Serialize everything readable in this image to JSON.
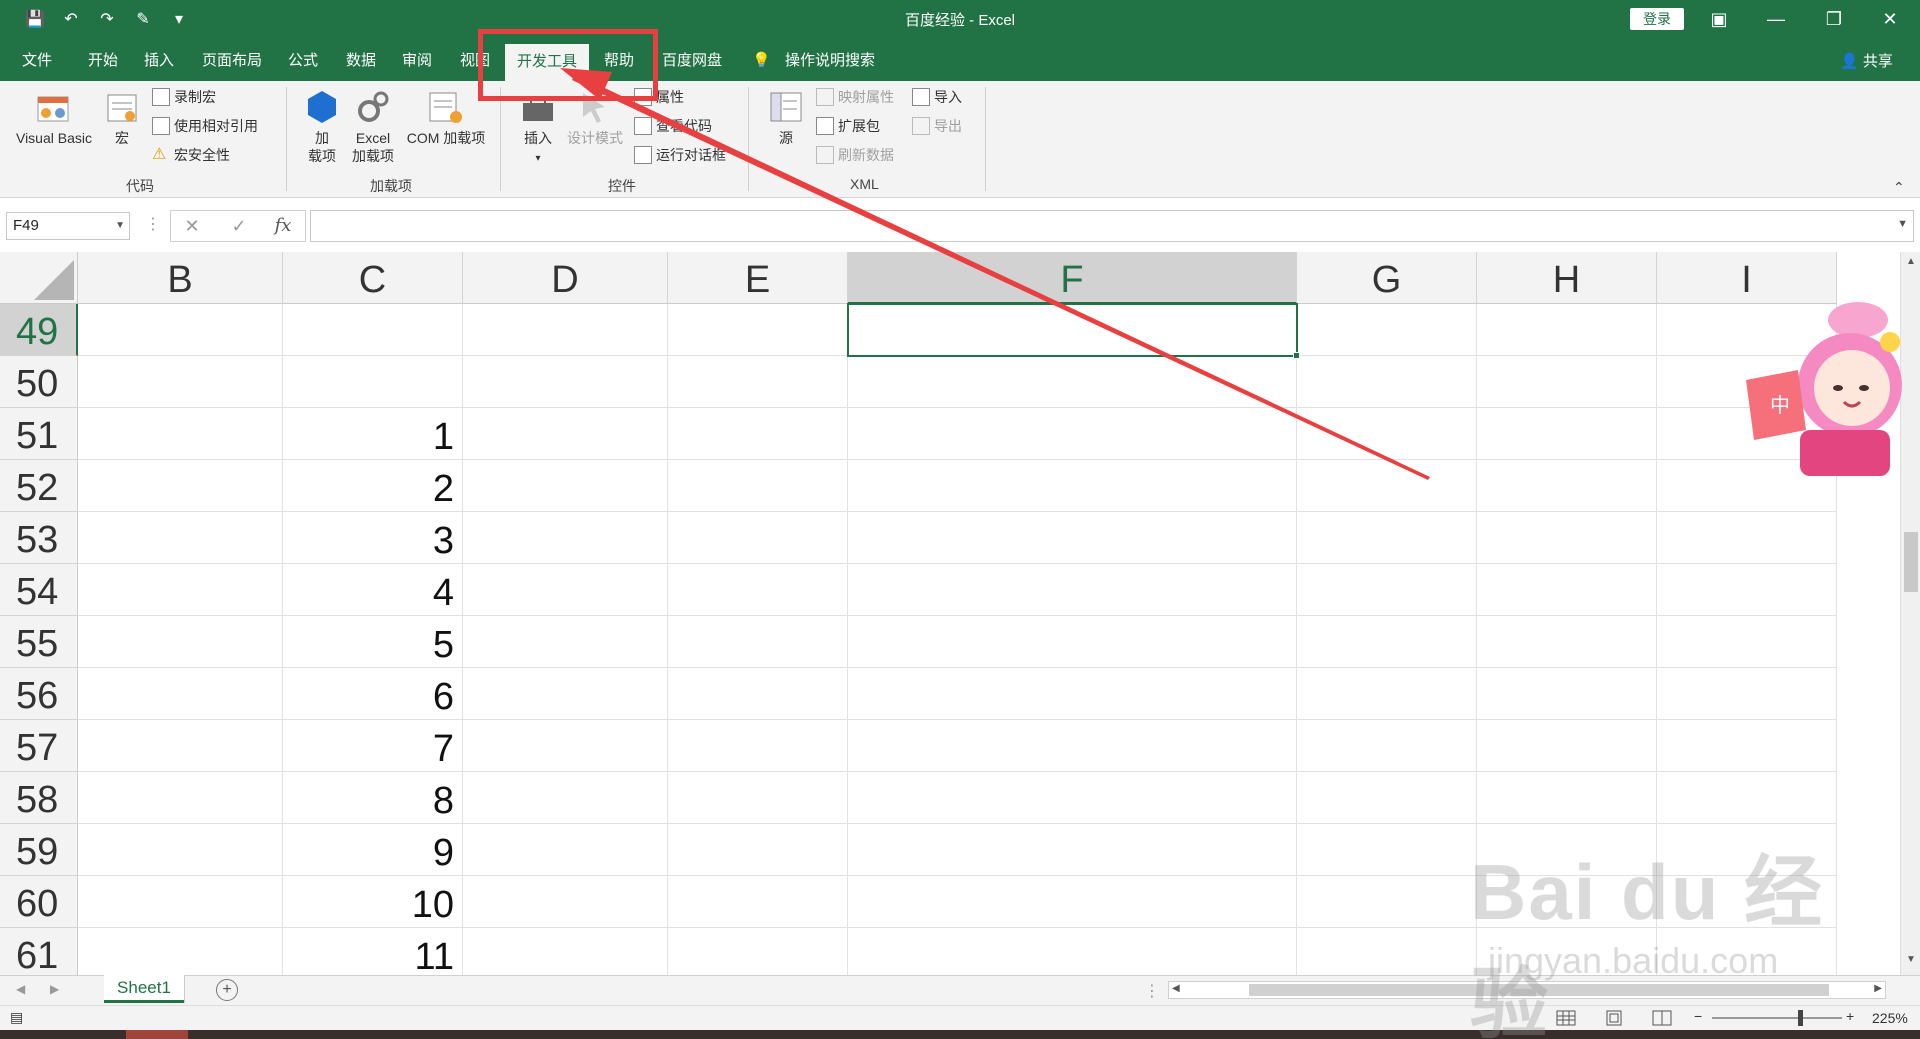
{
  "window": {
    "title": "百度经验 - Excel",
    "login_label": "登录",
    "share_label": "共享"
  },
  "tabs": [
    "文件",
    "开始",
    "插入",
    "页面布局",
    "公式",
    "数据",
    "审阅",
    "视图",
    "开发工具",
    "帮助",
    "百度网盘",
    "操作说明搜索"
  ],
  "active_tab": "开发工具",
  "ribbon": {
    "code": {
      "label": "代码",
      "visual_basic": "Visual Basic",
      "macro": "宏",
      "record_macro": "录制宏",
      "relative_ref": "使用相对引用",
      "macro_security": "宏安全性"
    },
    "addins": {
      "label": "加载项",
      "addin_line1": "加",
      "addin_line2": "载项",
      "excel_line1": "Excel",
      "excel_line2": "加载项",
      "com_addin": "COM 加载项"
    },
    "controls": {
      "label": "控件",
      "insert": "插入",
      "design_mode": "设计模式",
      "properties": "属性",
      "view_code": "查看代码",
      "run_dialog": "运行对话框"
    },
    "xml": {
      "label": "XML",
      "source": "源",
      "map_props": "映射属性",
      "expansion": "扩展包",
      "refresh_data": "刷新数据",
      "import": "导入",
      "export": "导出"
    }
  },
  "formula_bar": {
    "name_box": "F49",
    "fx_label": "fx",
    "formula": ""
  },
  "grid": {
    "columns": [
      "B",
      "C",
      "D",
      "E",
      "F",
      "G",
      "H",
      "I"
    ],
    "selected_column": "F",
    "rows": [
      {
        "num": "49",
        "c": ""
      },
      {
        "num": "50",
        "c": ""
      },
      {
        "num": "51",
        "c": "1"
      },
      {
        "num": "52",
        "c": "2"
      },
      {
        "num": "53",
        "c": "3"
      },
      {
        "num": "54",
        "c": "4"
      },
      {
        "num": "55",
        "c": "5"
      },
      {
        "num": "56",
        "c": "6"
      },
      {
        "num": "57",
        "c": "7"
      },
      {
        "num": "58",
        "c": "8"
      },
      {
        "num": "59",
        "c": "9"
      },
      {
        "num": "60",
        "c": "10"
      },
      {
        "num": "61",
        "c": "11"
      }
    ],
    "selected_row": "49"
  },
  "sheets": [
    "Sheet1"
  ],
  "status": {
    "zoom": "225%"
  },
  "watermark": {
    "main": "Bai du 经验",
    "sub": "jingyan.baidu.com"
  },
  "mascot": {
    "sign_text": "中"
  },
  "colors": {
    "excel_green": "#217346",
    "highlight_red": "#e84040"
  }
}
